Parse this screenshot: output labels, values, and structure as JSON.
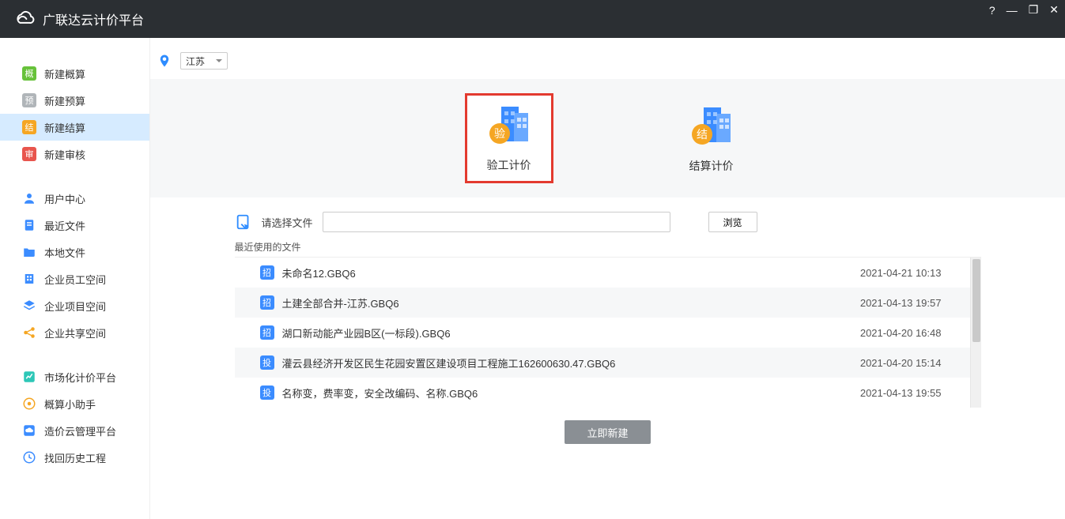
{
  "app_title": "广联达云计价平台",
  "window_controls": {
    "help": "?",
    "min": "—",
    "max": "❐",
    "close": "✕"
  },
  "region": {
    "selected": "江苏"
  },
  "sidebar": {
    "group1": [
      {
        "label": "新建概算",
        "icon_text": "概",
        "icon_color": "#67c23a"
      },
      {
        "label": "新建预算",
        "icon_text": "预",
        "icon_color": "#b0b5b9"
      },
      {
        "label": "新建结算",
        "icon_text": "结",
        "icon_color": "#f5a623",
        "active": true
      },
      {
        "label": "新建审核",
        "icon_text": "审",
        "icon_color": "#e8554d"
      }
    ],
    "group2": [
      {
        "label": "用户中心",
        "icon_text": "",
        "icon_color": "#3b8cff",
        "shape": "user"
      },
      {
        "label": "最近文件",
        "icon_text": "",
        "icon_color": "#3b8cff",
        "shape": "doc"
      },
      {
        "label": "本地文件",
        "icon_text": "",
        "icon_color": "#3b8cff",
        "shape": "folder"
      },
      {
        "label": "企业员工空间",
        "icon_text": "",
        "icon_color": "#3b8cff",
        "shape": "building"
      },
      {
        "label": "企业项目空间",
        "icon_text": "",
        "icon_color": "#3b8cff",
        "shape": "layers"
      },
      {
        "label": "企业共享空间",
        "icon_text": "",
        "icon_color": "#f5a623",
        "shape": "share"
      }
    ],
    "group3": [
      {
        "label": "市场化计价平台",
        "icon_color": "#2dc7b7",
        "shape": "market"
      },
      {
        "label": "概算小助手",
        "icon_color": "#f5a623",
        "shape": "assist"
      },
      {
        "label": "造价云管理平台",
        "icon_color": "#3b8cff",
        "shape": "cloud"
      },
      {
        "label": "找回历史工程",
        "icon_color": "#3b8cff",
        "shape": "history"
      }
    ]
  },
  "cards": [
    {
      "key": "yan",
      "label": "验工计价",
      "badge": "验",
      "badge_color": "#f5a623",
      "selected": true
    },
    {
      "key": "jie",
      "label": "结算计价",
      "badge": "结",
      "badge_color": "#f5a623",
      "selected": false
    }
  ],
  "file_panel": {
    "select_label": "请选择文件",
    "input_value": "",
    "browse_label": "浏览",
    "recent_label": "最近使用的文件",
    "create_label": "立即新建",
    "files": [
      {
        "tag": "招",
        "tag_color": "#3b8cff",
        "name": "未命名12.GBQ6",
        "time": "2021-04-21 10:13"
      },
      {
        "tag": "招",
        "tag_color": "#3b8cff",
        "name": "土建全部合并-江苏.GBQ6",
        "time": "2021-04-13 19:57"
      },
      {
        "tag": "招",
        "tag_color": "#3b8cff",
        "name": "湖口新动能产业园B区(一标段).GBQ6",
        "time": "2021-04-20 16:48"
      },
      {
        "tag": "投",
        "tag_color": "#3b8cff",
        "name": "灌云县经济开发区民生花园安置区建设项目工程施工162600630.47.GBQ6",
        "time": "2021-04-20 15:14"
      },
      {
        "tag": "投",
        "tag_color": "#3b8cff",
        "name": "名称变，费率变，安全改编码、名称.GBQ6",
        "time": "2021-04-13 19:55"
      }
    ]
  }
}
